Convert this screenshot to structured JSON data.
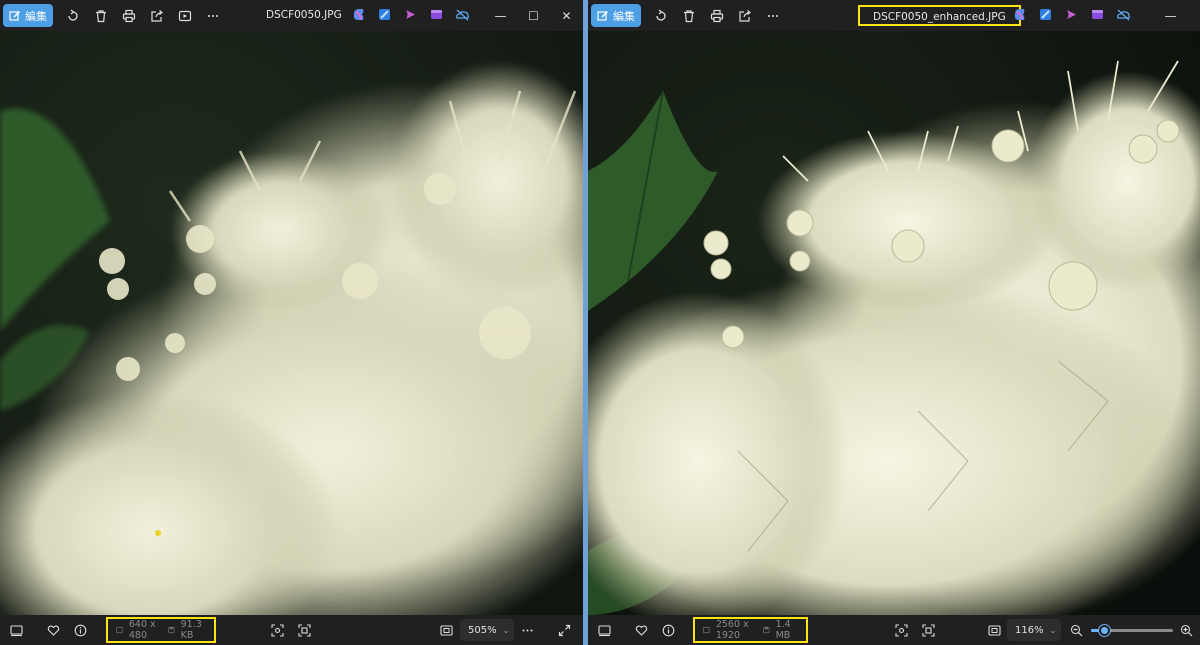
{
  "left": {
    "edit_label": "編集",
    "title": "DSCF0050.JPG",
    "dimensions": "640 x 480",
    "file_size": "91.3 KB",
    "zoom": "505%"
  },
  "right": {
    "edit_label": "編集",
    "title": "DSCF0050_enhanced.JPG",
    "dimensions": "2560 x 1920",
    "file_size": "1.4 MB",
    "zoom": "116%",
    "zoom_slider_level": 0.16
  },
  "colors": {
    "accent": "#4c9ee5",
    "highlight": "#ffe414",
    "divider": "#6fa2d8"
  },
  "icons": {
    "toolbar": [
      "edit-icon",
      "rotate-icon",
      "delete-icon",
      "print-icon",
      "share-icon",
      "slideshow-icon",
      "more-icon"
    ],
    "apps": [
      "copilot-icon",
      "designer-icon",
      "clipchamp-icon",
      "video-editor-icon",
      "onedrive-icon"
    ],
    "window": [
      "minimize-icon",
      "maximize-icon",
      "close-icon"
    ],
    "status": [
      "filmstrip-icon",
      "favorite-icon",
      "info-icon",
      "resolution-icon",
      "disk-icon",
      "face-detect-icon",
      "crop-detect-icon",
      "fit-to-window-icon",
      "chevron-down-icon",
      "more-icon",
      "fullscreen-icon",
      "zoom-out-icon",
      "zoom-in-icon"
    ]
  }
}
